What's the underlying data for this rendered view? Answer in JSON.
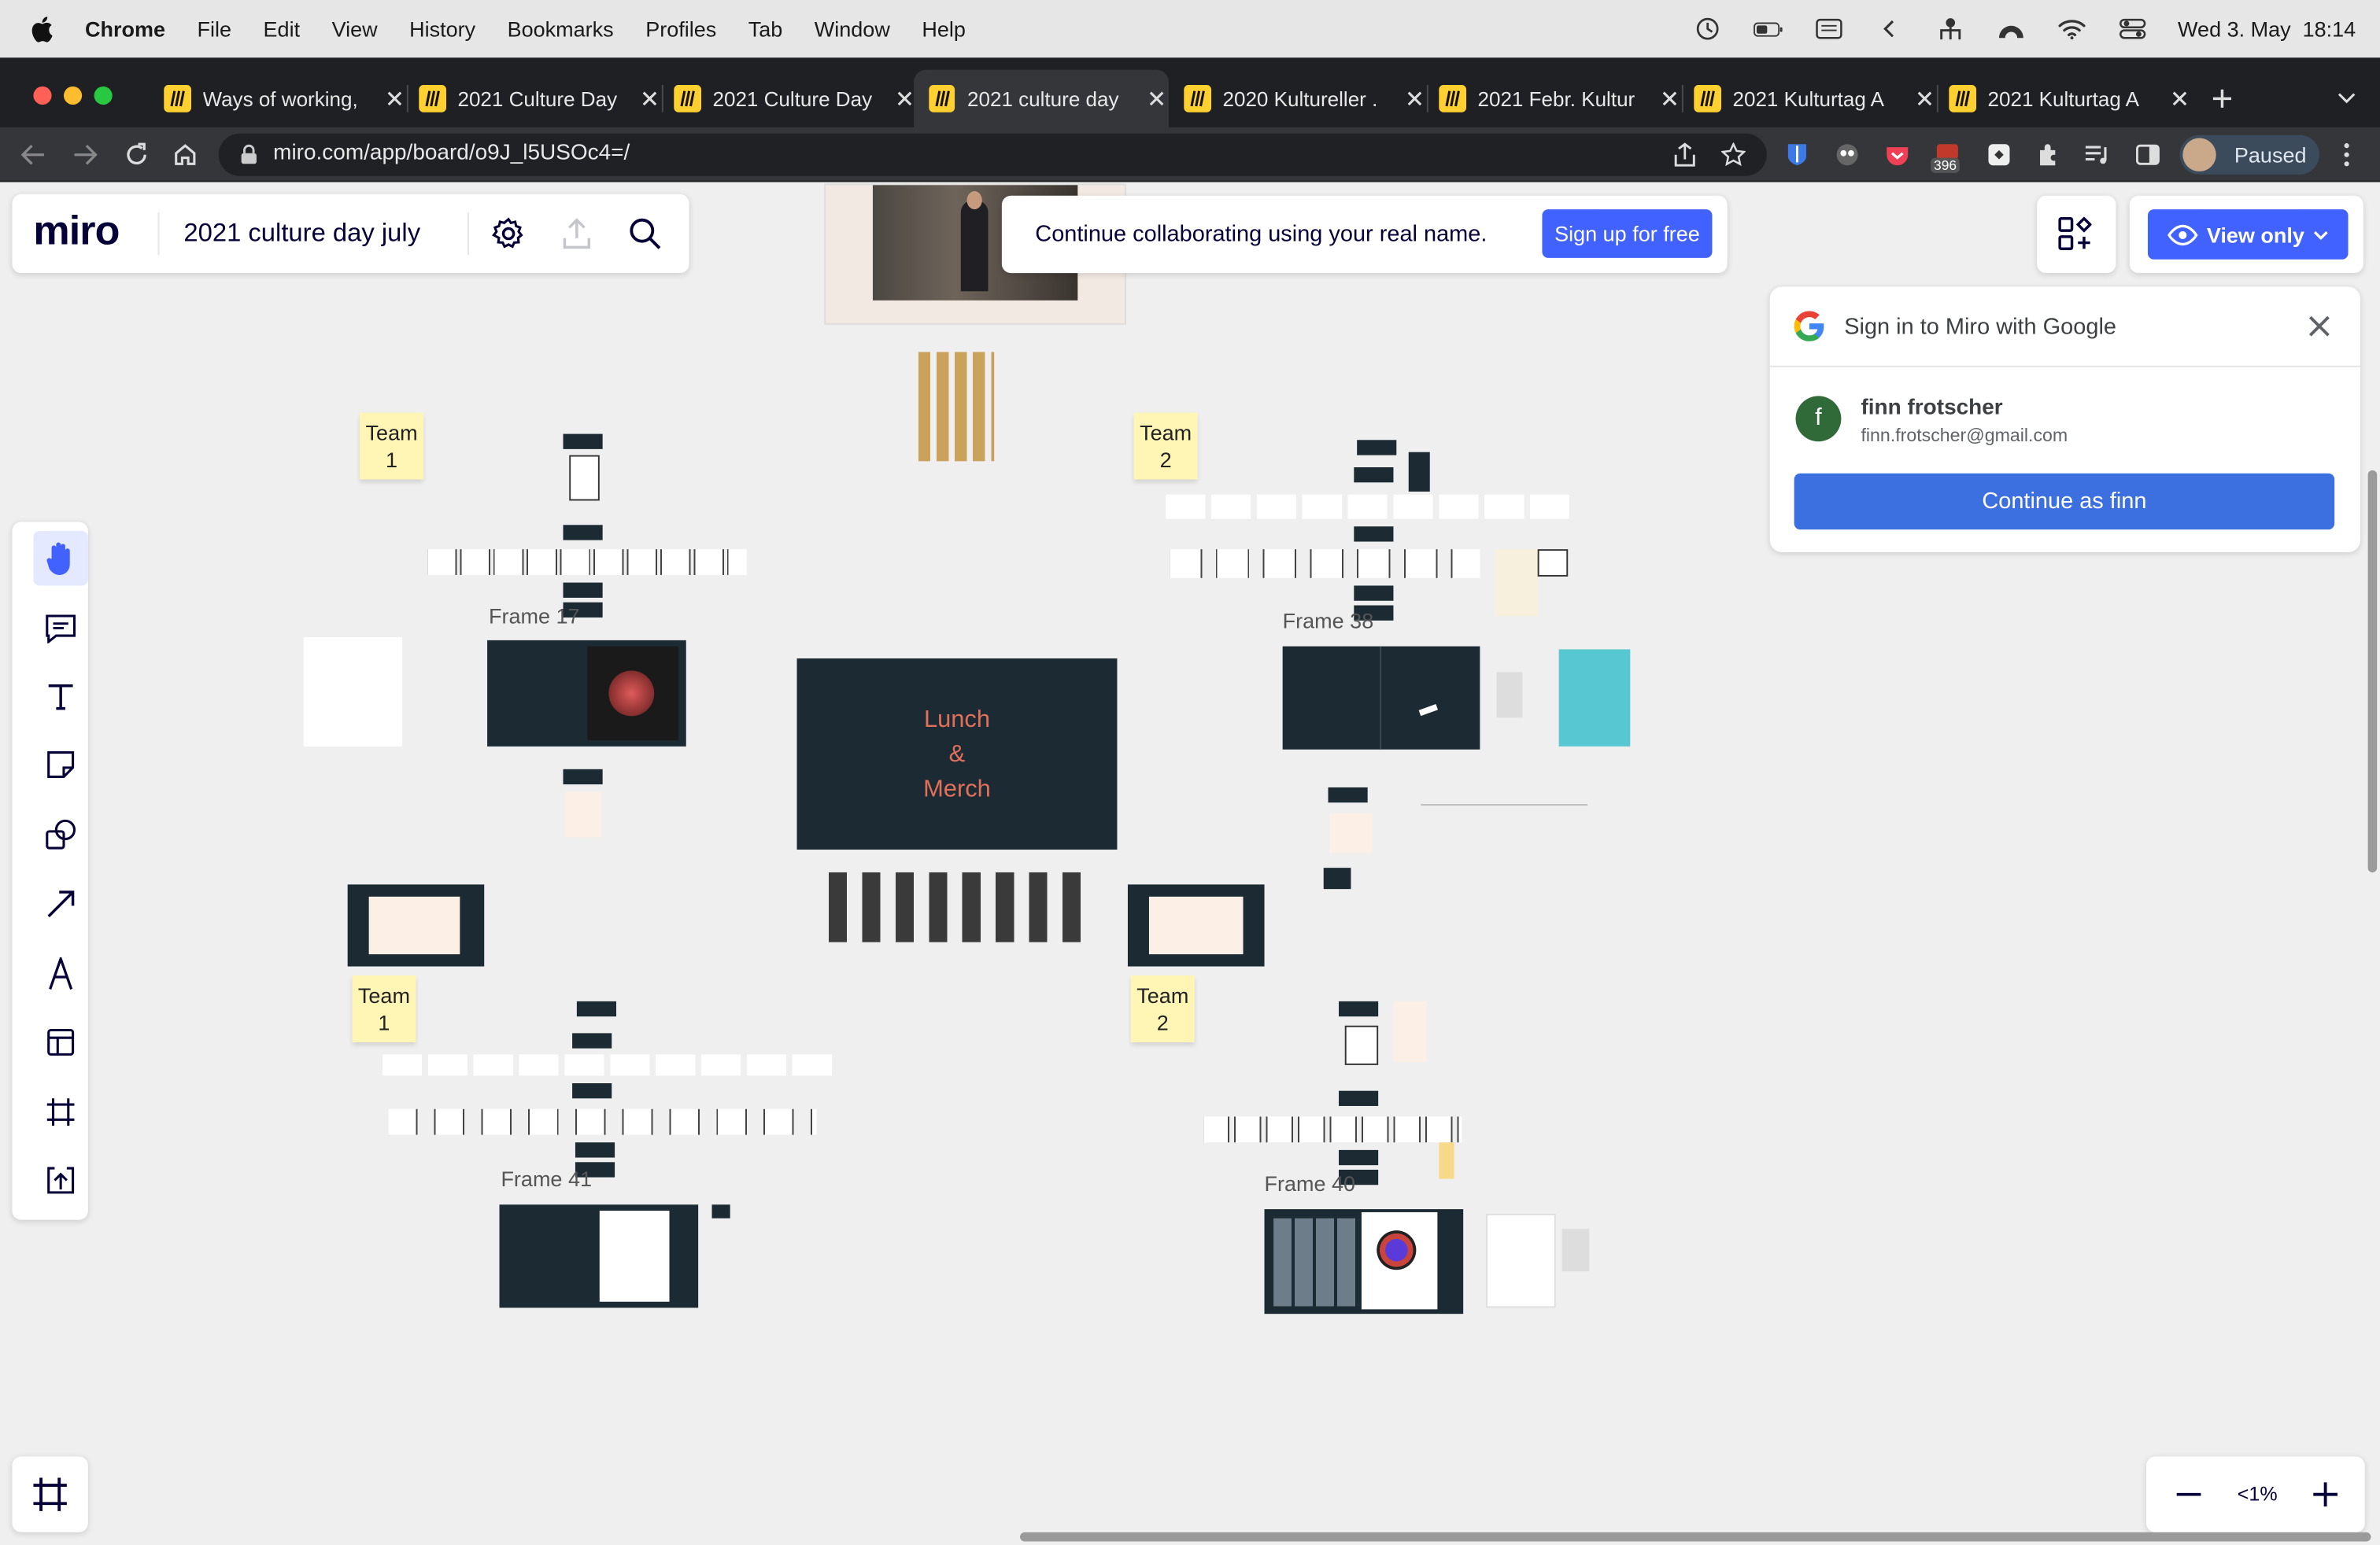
{
  "menubar": {
    "app": "Chrome",
    "items": [
      "File",
      "Edit",
      "View",
      "History",
      "Bookmarks",
      "Profiles",
      "Tab",
      "Window",
      "Help"
    ],
    "clock": "Wed 3. May  18:14"
  },
  "tabs": [
    {
      "title": "Ways of working,"
    },
    {
      "title": "2021 Culture Day"
    },
    {
      "title": "2021 Culture Day"
    },
    {
      "title": "2021 culture day"
    },
    {
      "title": "2020 Kultureller ."
    },
    {
      "title": "2021 Febr. Kultur"
    },
    {
      "title": "2021 Kulturtag A"
    },
    {
      "title": "2021 Kulturtag A"
    }
  ],
  "address": {
    "url": "miro.com/app/board/o9J_l5USOc4=/"
  },
  "extensions": {
    "badge": "396"
  },
  "profile": {
    "label": "Paused"
  },
  "board": {
    "logo": "miro",
    "title": "2021 culture day july"
  },
  "banner": {
    "text": "Continue collaborating using your real name.",
    "cta": "Sign up for free"
  },
  "view_only": {
    "label": "View only"
  },
  "google": {
    "title": "Sign in to Miro with Google",
    "name": "finn frotscher",
    "email": "finn.frotscher@gmail.com",
    "initial": "f",
    "continue": "Continue as finn"
  },
  "canvas": {
    "team1a": [
      "Team",
      "1"
    ],
    "team2a": [
      "Team",
      "2"
    ],
    "team1b": [
      "Team",
      "1"
    ],
    "team2b": [
      "Team",
      "2"
    ],
    "frame17": "Frame 17",
    "frame38": "Frame 38",
    "frame41": "Frame 41",
    "frame40": "Frame 40",
    "lunch": [
      "Lunch",
      "&",
      "Merch"
    ]
  },
  "zoom": {
    "level": "<1%"
  },
  "colors": {
    "accent": "#4262ff",
    "google_blue": "#3c6fe0",
    "dark_frame": "#1c2b33",
    "sticky": "#fff6b6",
    "lunch_text": "#e0705a"
  }
}
